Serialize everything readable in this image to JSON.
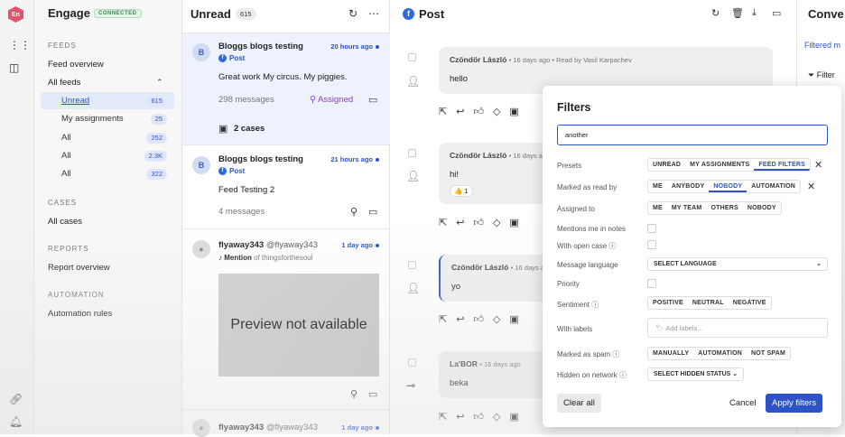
{
  "rail": {
    "logo": "En"
  },
  "sidebar": {
    "brand": "Engage",
    "status": "CONNECTED",
    "feeds_section": "FEEDS",
    "feed_overview": "Feed overview",
    "all_feeds": "All feeds",
    "items": [
      {
        "label": "Unread",
        "count": "615"
      },
      {
        "label": "My assignments",
        "count": "25"
      },
      {
        "label": "All",
        "count": "252"
      },
      {
        "label": "All",
        "count": "2.3K"
      },
      {
        "label": "All",
        "count": "322"
      }
    ],
    "cases_section": "CASES",
    "all_cases": "All cases",
    "reports_section": "REPORTS",
    "report_overview": "Report overview",
    "automation_section": "AUTOMATION",
    "automation_rules": "Automation rules"
  },
  "list": {
    "title": "Unread",
    "count": "615",
    "cards": [
      {
        "avatar": "B",
        "title": "Bloggs blogs testing",
        "time": "20 hours ago",
        "type": "Post",
        "text": "Great work My circus. My piggies.",
        "messages": "298 messages",
        "assigned": "Assigned",
        "cases": "2 cases"
      },
      {
        "avatar": "B",
        "title": "Bloggs blogs testing",
        "time": "21 hours ago",
        "type": "Post",
        "text": "Feed Testing 2",
        "messages": "4 messages"
      },
      {
        "name": "flyaway343",
        "handle": "@flyaway343",
        "time": "1 day ago",
        "type": "Mention",
        "of": "of thingsforthesoul",
        "preview": "Preview not available"
      },
      {
        "name": "flyaway343",
        "handle": "@flyaway343",
        "time": "1 day ago"
      }
    ]
  },
  "post": {
    "title": "Post",
    "messages": [
      {
        "author": "Czöndör László",
        "meta": "16 days ago",
        "read": "Read by Vasil Karpachev",
        "text": "hello"
      },
      {
        "author": "Czöndör László",
        "meta": "16 days ago",
        "text": "hi!",
        "reaction": "👍 1"
      },
      {
        "author": "Czöndör László",
        "meta": "16 days ago",
        "text": "yo"
      },
      {
        "author": "La'BOR",
        "meta": "16 days ago",
        "text": "beka"
      }
    ]
  },
  "right": {
    "title": "Conve",
    "tab": "Filtered m",
    "filter": "Filter"
  },
  "filters": {
    "title": "Filters",
    "search_value": "another",
    "presets_label": "Presets",
    "presets": [
      "UNREAD",
      "MY ASSIGNMENTS",
      "FEED FILTERS"
    ],
    "read_label": "Marked as read by",
    "read": [
      "ME",
      "ANYBODY",
      "NOBODY",
      "AUTOMATION"
    ],
    "assigned_label": "Assigned to",
    "assigned": [
      "ME",
      "MY TEAM",
      "OTHERS",
      "NOBODY"
    ],
    "mentions_label": "Mentions me in notes",
    "open_case_label": "With open case",
    "language_label": "Message language",
    "language_value": "SELECT LANGUAGE",
    "priority_label": "Priority",
    "sentiment_label": "Sentiment",
    "sentiment": [
      "POSITIVE",
      "NEUTRAL",
      "NEGATIVE"
    ],
    "labels_label": "With labels",
    "labels_placeholder": "Add labels...",
    "spam_label": "Marked as spam",
    "spam": [
      "MANUALLY",
      "AUTOMATION",
      "NOT SPAM"
    ],
    "hidden_label": "Hidden on network",
    "hidden_value": "SELECT HIDDEN STATUS",
    "clear": "Clear all",
    "cancel": "Cancel",
    "apply": "Apply filters"
  }
}
